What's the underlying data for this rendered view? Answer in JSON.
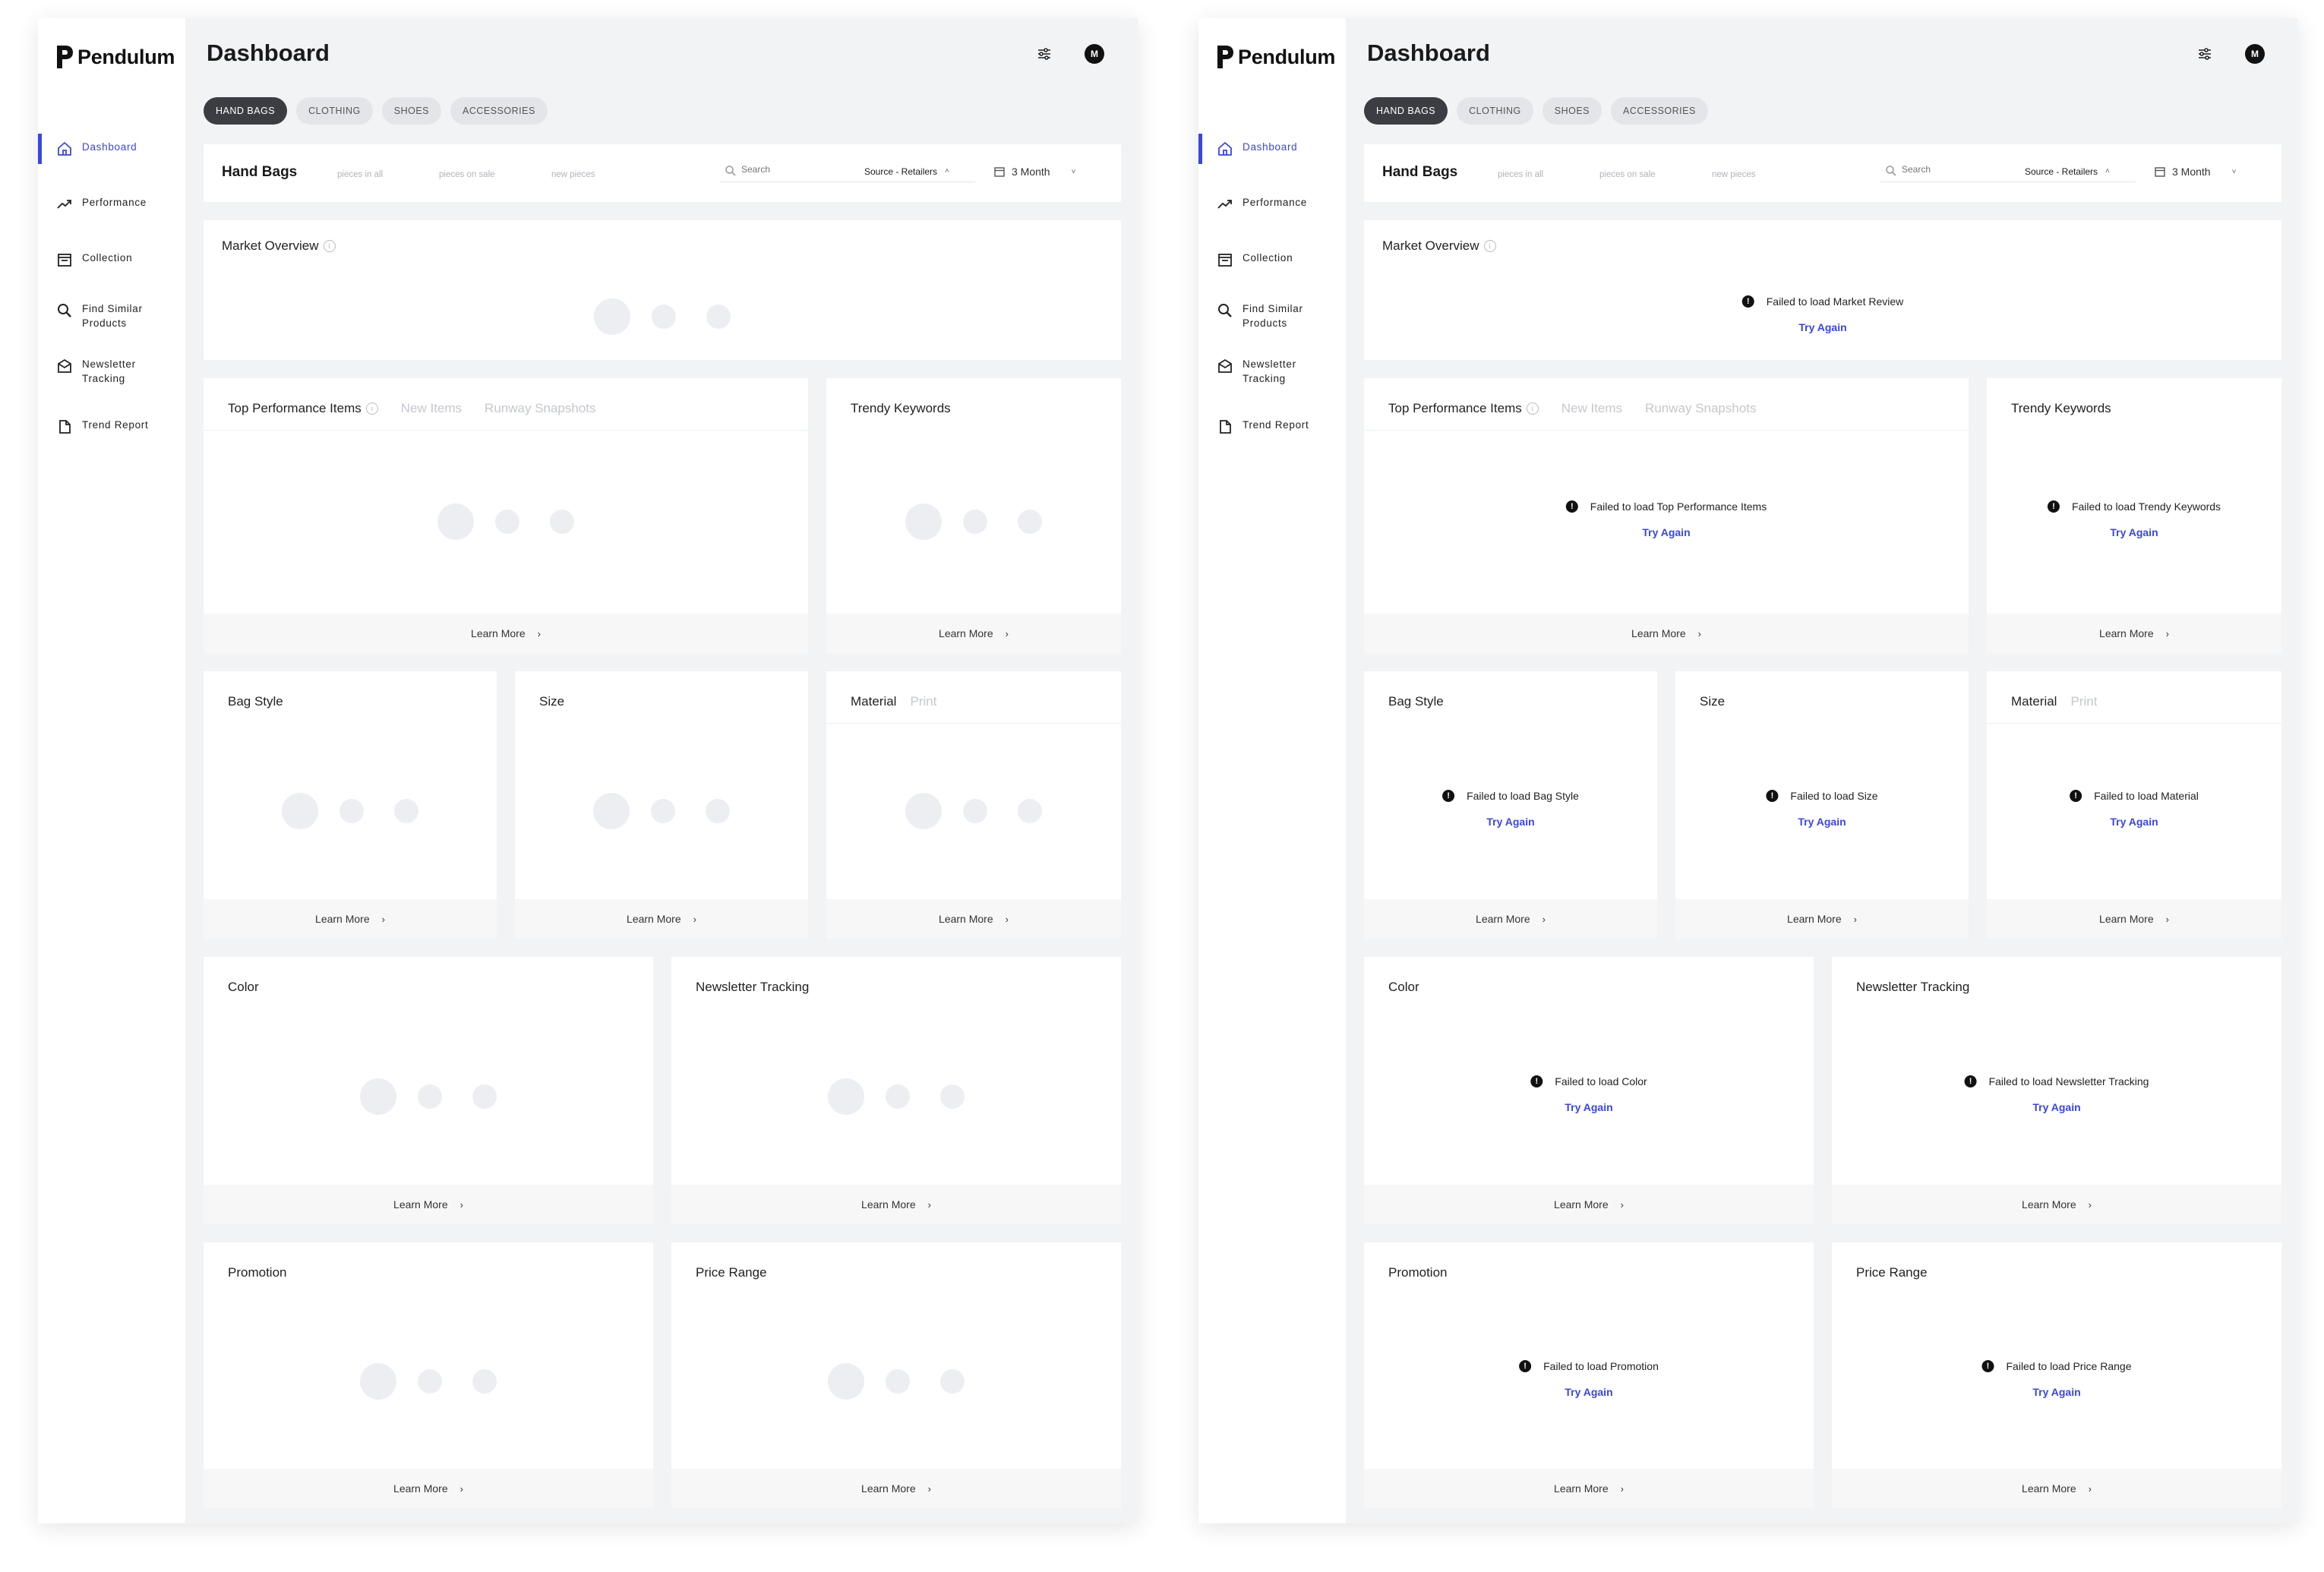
{
  "brand": {
    "name": "Pendulum",
    "accent": "#3a46e0"
  },
  "sidebar": {
    "items": [
      {
        "label": "Dashboard",
        "icon": "home-icon"
      },
      {
        "label": "Performance",
        "icon": "trending-up-icon"
      },
      {
        "label": "Collection",
        "icon": "folder-icon"
      },
      {
        "label": "Find Similar Products",
        "icon": "search-icon"
      },
      {
        "label": "Newsletter Tracking",
        "icon": "mail-icon"
      },
      {
        "label": "Trend Report",
        "icon": "document-icon"
      }
    ]
  },
  "header": {
    "title": "Dashboard",
    "avatar": "M"
  },
  "tabs": [
    "HAND BAGS",
    "CLOTHING",
    "SHOES",
    "ACCESSORIES"
  ],
  "filter": {
    "title": "Hand Bags",
    "meta": [
      "pieces in all",
      "pieces on sale",
      "new pieces"
    ],
    "search_placeholder": "Search",
    "source": "Source - Retailers",
    "period": "3 Month"
  },
  "cards": {
    "market": {
      "title": "Market Overview",
      "error": "Failed to load Market Review"
    },
    "top": {
      "title": "Top Performance Items",
      "tab2": "New Items",
      "tab3": "Runway Snapshots",
      "error": "Failed to load Top Performance Items"
    },
    "trendy": {
      "title": "Trendy Keywords",
      "error": "Failed to load Trendy Keywords"
    },
    "bag": {
      "title": "Bag Style",
      "error": "Failed to load Bag Style"
    },
    "size": {
      "title": "Size",
      "error": "Failed to load Size"
    },
    "material": {
      "title": "Material",
      "tab2": "Print",
      "error": "Failed to load Material"
    },
    "color": {
      "title": "Color",
      "error": "Failed to load Color"
    },
    "newsletter": {
      "title": "Newsletter Tracking",
      "error": "Failed to load Newsletter Tracking"
    },
    "promotion": {
      "title": "Promotion",
      "error": "Failed to load Promotion"
    },
    "price": {
      "title": "Price Range",
      "error": "Failed to load Price Range"
    }
  },
  "common": {
    "learn_more": "Learn More",
    "try_again": "Try Again"
  }
}
